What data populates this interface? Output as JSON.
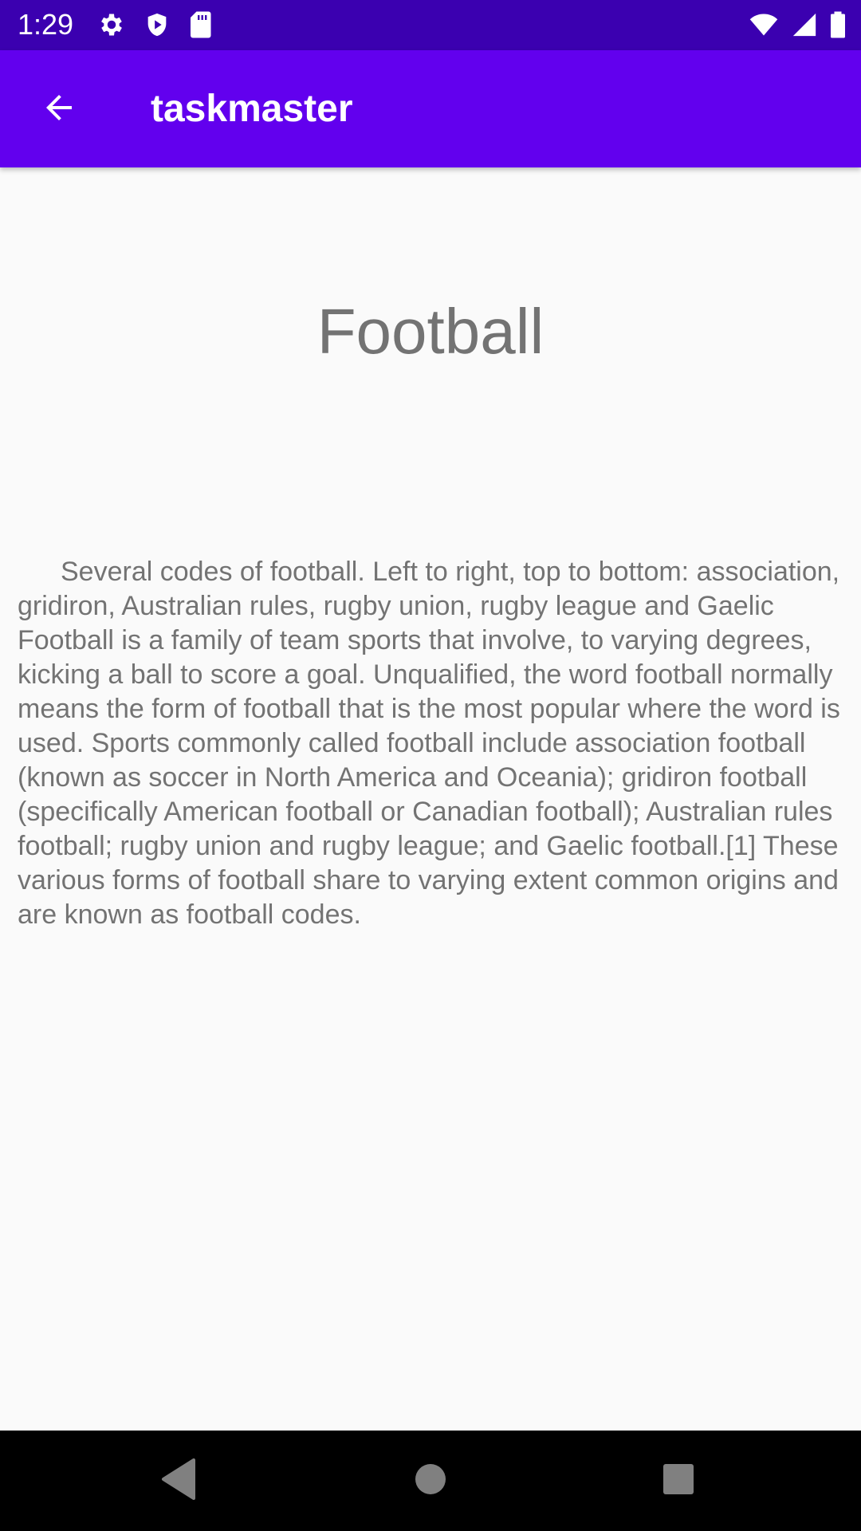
{
  "status_bar": {
    "time": "1:29",
    "left_icons": [
      "settings-icon",
      "shield-play-icon",
      "sd-card-icon"
    ],
    "right_icons": [
      "wifi-icon",
      "cell-signal-icon",
      "battery-icon"
    ],
    "background": "#3b00b0"
  },
  "app_bar": {
    "title": "taskmaster",
    "background": "#6200ee",
    "back_icon": "arrow-back-icon"
  },
  "task": {
    "title": "Football",
    "body": "Several codes of football. Left to right, top to bottom: association, gridiron, Australian rules, rugby union, rugby league and Gaelic Football is a family of team sports that involve, to varying degrees, kicking a ball to score a goal. Unqualified, the word football normally means the form of football that is the most popular where the word is used. Sports commonly called football include association football (known as soccer in North America and Oceania); gridiron football (specifically American football or Canadian football); Australian rules football; rugby union and rugby league; and Gaelic football.[1] These various forms of football share to varying extent common origins and are known as football codes."
  },
  "nav_bar": {
    "buttons": [
      "back-triangle-icon",
      "home-circle-icon",
      "recents-square-icon"
    ]
  }
}
